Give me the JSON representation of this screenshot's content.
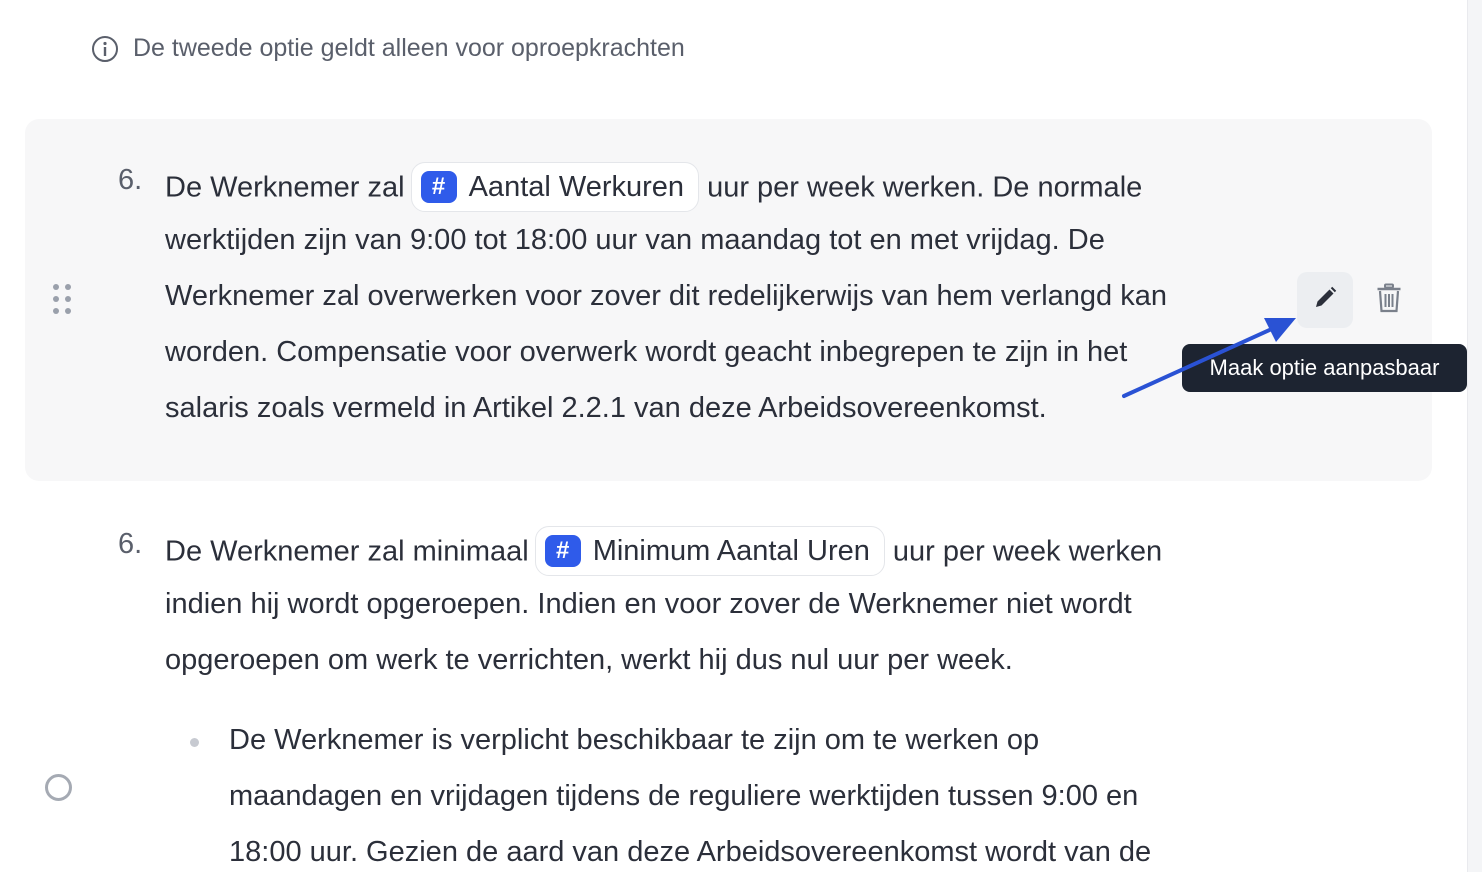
{
  "info_note": {
    "icon": "info-icon",
    "text": "De tweede optie geldt alleen voor oproepkrachten"
  },
  "option_1": {
    "number": "6.",
    "line1_before": "De Werknemer zal",
    "variable": {
      "icon": "hash-icon",
      "symbol": "#",
      "label": "Aantal Werkuren"
    },
    "line1_after": "uur per week werken. De normale",
    "lines": [
      "werktijden zijn van 9:00 tot 18:00 uur van maandag tot en met vrijdag. De",
      "Werknemer zal overwerken voor zover dit redelijkerwijs van hem verlangd kan",
      "worden. Compensatie voor overwerk wordt geacht inbegrepen te zijn in het",
      "salaris zoals vermeld in Artikel 2.2.1 van deze Arbeidsovereenkomst."
    ],
    "actions": {
      "edit_icon": "pencil-icon",
      "delete_icon": "trash-icon",
      "tooltip": "Maak optie aanpasbaar"
    }
  },
  "option_2": {
    "number": "6.",
    "line1_before": "De Werknemer zal minimaal",
    "variable": {
      "icon": "hash-icon",
      "symbol": "#",
      "label": "Minimum Aantal Uren"
    },
    "line1_after": "uur per week werken",
    "lines": [
      "indien hij wordt opgeroepen. Indien en voor zover de Werknemer niet wordt",
      "opgeroepen om werk te verrichten, werkt hij dus nul uur per week."
    ],
    "bullet_lines": [
      "De Werknemer is verplicht beschikbaar te zijn om te werken op",
      "maandagen en vrijdagen tijdens de reguliere werktijden tussen 9:00 en",
      "18:00 uur. Gezien de aard van deze Arbeidsovereenkomst wordt van de"
    ]
  },
  "colors": {
    "accent": "#2f5bea",
    "tooltip_bg": "#1d2431",
    "card_bg": "#f7f7f8",
    "text": "#2b2f3a"
  }
}
